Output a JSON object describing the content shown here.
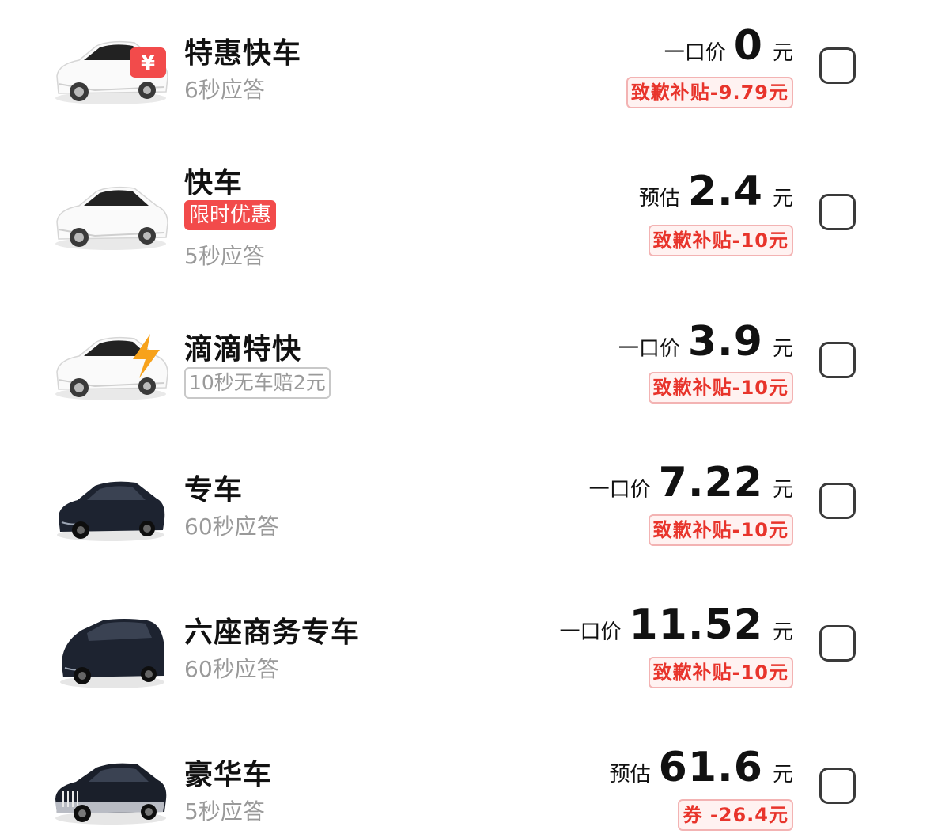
{
  "colors": {
    "accent": "#f24b4b",
    "subsidy_text": "#e8342b",
    "subsidy_bg": "#fff2f1",
    "muted": "#9a9a9a"
  },
  "options": [
    {
      "name": "特惠快车",
      "badge_icon": "yen-coupon-icon",
      "eta": "6秒应答",
      "price_prefix": "一口价",
      "price": "0",
      "unit": "元",
      "subsidy": "致歉补贴-9.79元",
      "selected": false
    },
    {
      "name": "快车",
      "promo_tag": "限时优惠",
      "eta": "5秒应答",
      "price_prefix": "预估",
      "price": "2.4",
      "unit": "元",
      "subsidy": "致歉补贴-10元",
      "selected": false
    },
    {
      "name": "滴滴特快",
      "badge_icon": "lightning-icon",
      "tag": "10秒无车赔2元",
      "price_prefix": "一口价",
      "price": "3.9",
      "unit": "元",
      "subsidy": "致歉补贴-10元",
      "selected": false
    },
    {
      "name": "专车",
      "eta": "60秒应答",
      "price_prefix": "一口价",
      "price": "7.22",
      "unit": "元",
      "subsidy": "致歉补贴-10元",
      "selected": false
    },
    {
      "name": "六座商务专车",
      "eta": "60秒应答",
      "price_prefix": "一口价",
      "price": "11.52",
      "unit": "元",
      "subsidy": "致歉补贴-10元",
      "selected": false
    },
    {
      "name": "豪华车",
      "eta": "5秒应答",
      "price_prefix": "预估",
      "price": "61.6",
      "unit": "元",
      "subsidy": "券 -26.4元",
      "selected": false
    }
  ]
}
